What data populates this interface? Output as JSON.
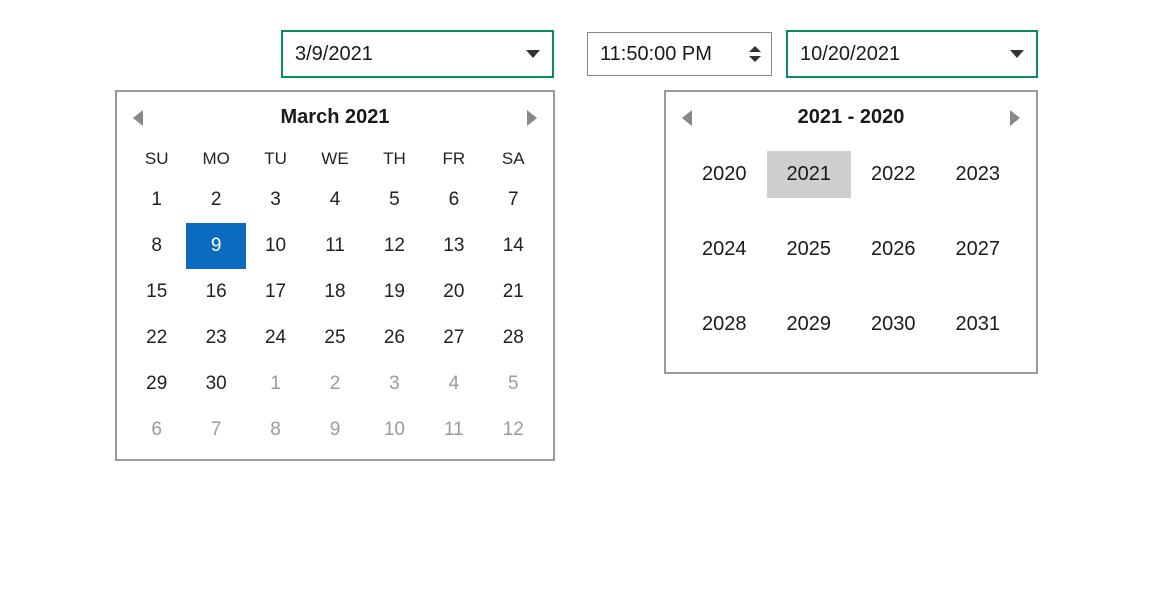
{
  "left_date_field": {
    "value": "3/9/2021"
  },
  "time_field": {
    "value": "11:50:00 PM"
  },
  "right_date_field": {
    "value": "10/20/2021"
  },
  "calendar": {
    "title": "March 2021",
    "dow": [
      "SU",
      "MO",
      "TU",
      "WE",
      "TH",
      "FR",
      "SA"
    ],
    "weeks": [
      [
        {
          "n": "1"
        },
        {
          "n": "2"
        },
        {
          "n": "3"
        },
        {
          "n": "4"
        },
        {
          "n": "5"
        },
        {
          "n": "6"
        },
        {
          "n": "7"
        }
      ],
      [
        {
          "n": "8"
        },
        {
          "n": "9",
          "selected": true
        },
        {
          "n": "10"
        },
        {
          "n": "11"
        },
        {
          "n": "12"
        },
        {
          "n": "13"
        },
        {
          "n": "14"
        }
      ],
      [
        {
          "n": "15"
        },
        {
          "n": "16"
        },
        {
          "n": "17"
        },
        {
          "n": "18"
        },
        {
          "n": "19"
        },
        {
          "n": "20"
        },
        {
          "n": "21"
        }
      ],
      [
        {
          "n": "22"
        },
        {
          "n": "23"
        },
        {
          "n": "24"
        },
        {
          "n": "25"
        },
        {
          "n": "26"
        },
        {
          "n": "27"
        },
        {
          "n": "28"
        }
      ],
      [
        {
          "n": "29"
        },
        {
          "n": "30"
        },
        {
          "n": "1",
          "other": true
        },
        {
          "n": "2",
          "other": true
        },
        {
          "n": "3",
          "other": true
        },
        {
          "n": "4",
          "other": true
        },
        {
          "n": "5",
          "other": true
        }
      ],
      [
        {
          "n": "6",
          "other": true
        },
        {
          "n": "7",
          "other": true
        },
        {
          "n": "8",
          "other": true
        },
        {
          "n": "9",
          "other": true
        },
        {
          "n": "10",
          "other": true
        },
        {
          "n": "11",
          "other": true
        },
        {
          "n": "12",
          "other": true
        }
      ]
    ]
  },
  "year_picker": {
    "title": "2021 - 2020",
    "years": [
      {
        "y": "2020"
      },
      {
        "y": "2021",
        "selected": true
      },
      {
        "y": "2022"
      },
      {
        "y": "2023"
      },
      {
        "y": "2024"
      },
      {
        "y": "2025"
      },
      {
        "y": "2026"
      },
      {
        "y": "2027"
      },
      {
        "y": "2028"
      },
      {
        "y": "2029"
      },
      {
        "y": "2030"
      },
      {
        "y": "2031"
      }
    ]
  }
}
